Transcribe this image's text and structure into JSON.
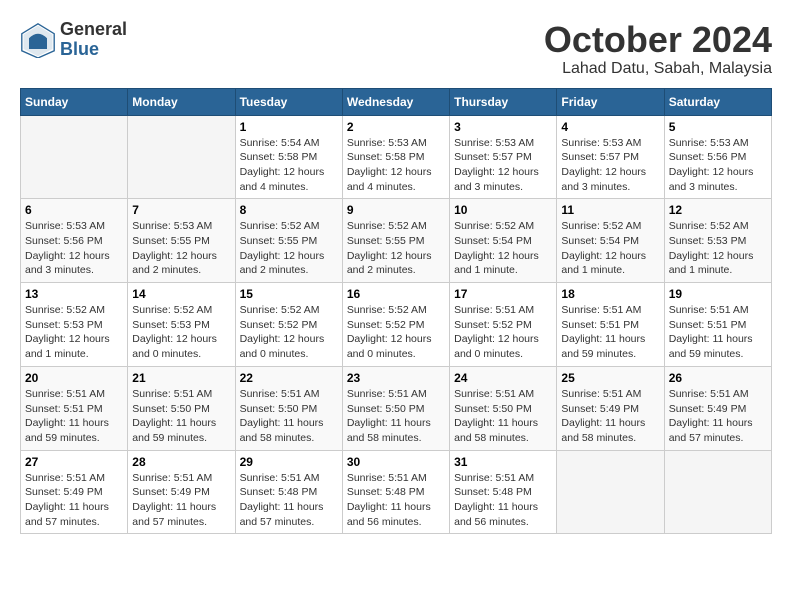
{
  "logo": {
    "general": "General",
    "blue": "Blue"
  },
  "title": "October 2024",
  "subtitle": "Lahad Datu, Sabah, Malaysia",
  "weekdays": [
    "Sunday",
    "Monday",
    "Tuesday",
    "Wednesday",
    "Thursday",
    "Friday",
    "Saturday"
  ],
  "weeks": [
    [
      {
        "day": "",
        "info": ""
      },
      {
        "day": "",
        "info": ""
      },
      {
        "day": "1",
        "info": "Sunrise: 5:54 AM\nSunset: 5:58 PM\nDaylight: 12 hours and 4 minutes."
      },
      {
        "day": "2",
        "info": "Sunrise: 5:53 AM\nSunset: 5:58 PM\nDaylight: 12 hours and 4 minutes."
      },
      {
        "day": "3",
        "info": "Sunrise: 5:53 AM\nSunset: 5:57 PM\nDaylight: 12 hours and 3 minutes."
      },
      {
        "day": "4",
        "info": "Sunrise: 5:53 AM\nSunset: 5:57 PM\nDaylight: 12 hours and 3 minutes."
      },
      {
        "day": "5",
        "info": "Sunrise: 5:53 AM\nSunset: 5:56 PM\nDaylight: 12 hours and 3 minutes."
      }
    ],
    [
      {
        "day": "6",
        "info": "Sunrise: 5:53 AM\nSunset: 5:56 PM\nDaylight: 12 hours and 3 minutes."
      },
      {
        "day": "7",
        "info": "Sunrise: 5:53 AM\nSunset: 5:55 PM\nDaylight: 12 hours and 2 minutes."
      },
      {
        "day": "8",
        "info": "Sunrise: 5:52 AM\nSunset: 5:55 PM\nDaylight: 12 hours and 2 minutes."
      },
      {
        "day": "9",
        "info": "Sunrise: 5:52 AM\nSunset: 5:55 PM\nDaylight: 12 hours and 2 minutes."
      },
      {
        "day": "10",
        "info": "Sunrise: 5:52 AM\nSunset: 5:54 PM\nDaylight: 12 hours and 1 minute."
      },
      {
        "day": "11",
        "info": "Sunrise: 5:52 AM\nSunset: 5:54 PM\nDaylight: 12 hours and 1 minute."
      },
      {
        "day": "12",
        "info": "Sunrise: 5:52 AM\nSunset: 5:53 PM\nDaylight: 12 hours and 1 minute."
      }
    ],
    [
      {
        "day": "13",
        "info": "Sunrise: 5:52 AM\nSunset: 5:53 PM\nDaylight: 12 hours and 1 minute."
      },
      {
        "day": "14",
        "info": "Sunrise: 5:52 AM\nSunset: 5:53 PM\nDaylight: 12 hours and 0 minutes."
      },
      {
        "day": "15",
        "info": "Sunrise: 5:52 AM\nSunset: 5:52 PM\nDaylight: 12 hours and 0 minutes."
      },
      {
        "day": "16",
        "info": "Sunrise: 5:52 AM\nSunset: 5:52 PM\nDaylight: 12 hours and 0 minutes."
      },
      {
        "day": "17",
        "info": "Sunrise: 5:51 AM\nSunset: 5:52 PM\nDaylight: 12 hours and 0 minutes."
      },
      {
        "day": "18",
        "info": "Sunrise: 5:51 AM\nSunset: 5:51 PM\nDaylight: 11 hours and 59 minutes."
      },
      {
        "day": "19",
        "info": "Sunrise: 5:51 AM\nSunset: 5:51 PM\nDaylight: 11 hours and 59 minutes."
      }
    ],
    [
      {
        "day": "20",
        "info": "Sunrise: 5:51 AM\nSunset: 5:51 PM\nDaylight: 11 hours and 59 minutes."
      },
      {
        "day": "21",
        "info": "Sunrise: 5:51 AM\nSunset: 5:50 PM\nDaylight: 11 hours and 59 minutes."
      },
      {
        "day": "22",
        "info": "Sunrise: 5:51 AM\nSunset: 5:50 PM\nDaylight: 11 hours and 58 minutes."
      },
      {
        "day": "23",
        "info": "Sunrise: 5:51 AM\nSunset: 5:50 PM\nDaylight: 11 hours and 58 minutes."
      },
      {
        "day": "24",
        "info": "Sunrise: 5:51 AM\nSunset: 5:50 PM\nDaylight: 11 hours and 58 minutes."
      },
      {
        "day": "25",
        "info": "Sunrise: 5:51 AM\nSunset: 5:49 PM\nDaylight: 11 hours and 58 minutes."
      },
      {
        "day": "26",
        "info": "Sunrise: 5:51 AM\nSunset: 5:49 PM\nDaylight: 11 hours and 57 minutes."
      }
    ],
    [
      {
        "day": "27",
        "info": "Sunrise: 5:51 AM\nSunset: 5:49 PM\nDaylight: 11 hours and 57 minutes."
      },
      {
        "day": "28",
        "info": "Sunrise: 5:51 AM\nSunset: 5:49 PM\nDaylight: 11 hours and 57 minutes."
      },
      {
        "day": "29",
        "info": "Sunrise: 5:51 AM\nSunset: 5:48 PM\nDaylight: 11 hours and 57 minutes."
      },
      {
        "day": "30",
        "info": "Sunrise: 5:51 AM\nSunset: 5:48 PM\nDaylight: 11 hours and 56 minutes."
      },
      {
        "day": "31",
        "info": "Sunrise: 5:51 AM\nSunset: 5:48 PM\nDaylight: 11 hours and 56 minutes."
      },
      {
        "day": "",
        "info": ""
      },
      {
        "day": "",
        "info": ""
      }
    ]
  ]
}
